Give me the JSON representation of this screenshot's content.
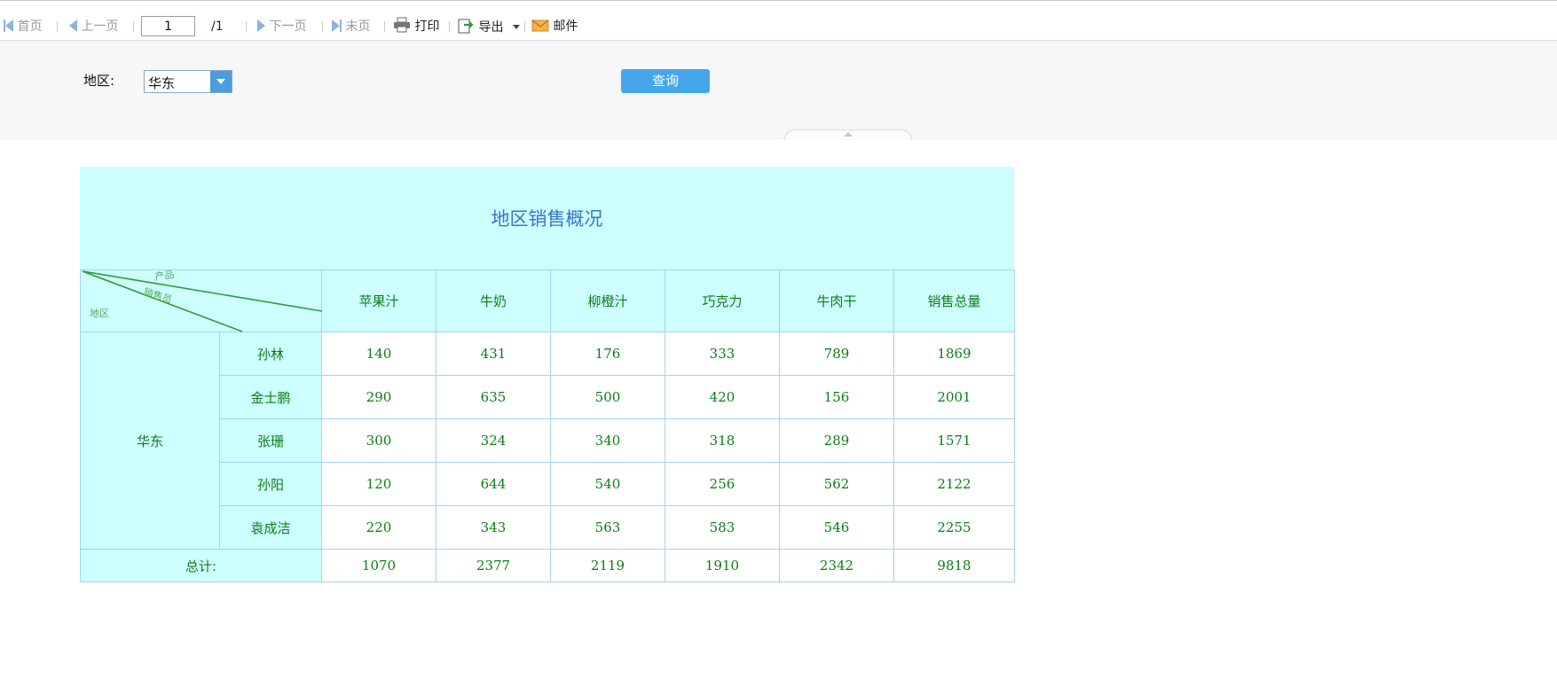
{
  "toolbar": {
    "first": "首页",
    "prev": "上一页",
    "page_value": "1",
    "page_total": "/1",
    "next": "下一页",
    "last": "末页",
    "print": "打印",
    "export": "导出",
    "mail": "邮件"
  },
  "params": {
    "region_label": "地区:",
    "region_value": "华东",
    "query_label": "查询"
  },
  "report": {
    "title": "地区销售概况",
    "corner": {
      "product": "产品",
      "salesperson": "销售员",
      "region": "地区"
    },
    "columns": [
      "苹果汁",
      "牛奶",
      "柳橙汁",
      "巧克力",
      "牛肉干",
      "销售总量"
    ],
    "region": "华东",
    "rows": [
      {
        "name": "孙林",
        "values": [
          "140",
          "431",
          "176",
          "333",
          "789",
          "1869"
        ]
      },
      {
        "name": "金士鹏",
        "values": [
          "290",
          "635",
          "500",
          "420",
          "156",
          "2001"
        ]
      },
      {
        "name": "张珊",
        "values": [
          "300",
          "324",
          "340",
          "318",
          "289",
          "1571"
        ]
      },
      {
        "name": "孙阳",
        "values": [
          "120",
          "644",
          "540",
          "256",
          "562",
          "2122"
        ]
      },
      {
        "name": "袁成洁",
        "values": [
          "220",
          "343",
          "563",
          "583",
          "546",
          "2255"
        ]
      }
    ],
    "total_label": "总计:",
    "totals": [
      "1070",
      "2377",
      "2119",
      "1910",
      "2342",
      "9818"
    ]
  },
  "colors": {
    "header_bg": "#ccfffe",
    "grid_line": "#a6d2f1",
    "cell_text": "#0d7d15",
    "title_text": "#3a73c9",
    "query_button": "#45a6eb"
  }
}
